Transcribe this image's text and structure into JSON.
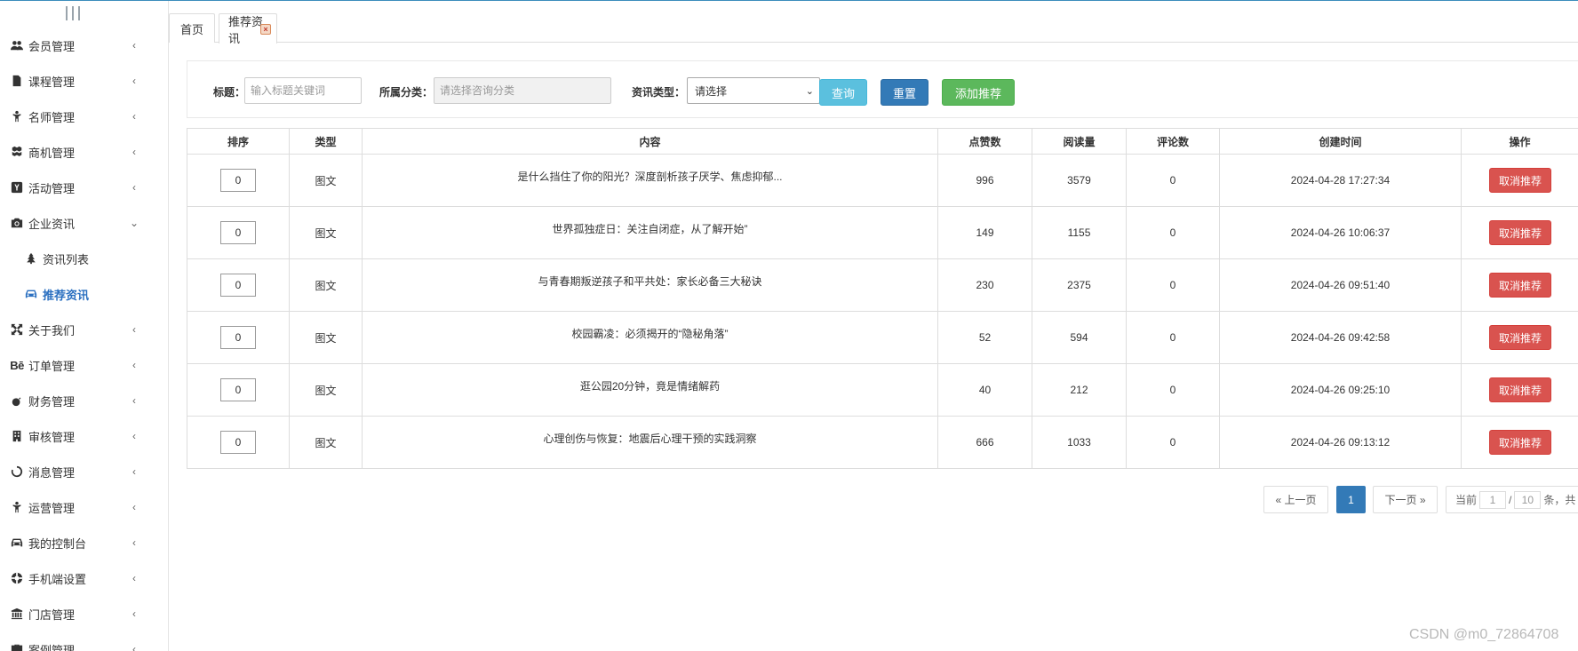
{
  "sidebar": {
    "items": [
      {
        "label": "会员管理",
        "icon": "users-icon",
        "chevron": "‹"
      },
      {
        "label": "课程管理",
        "icon": "file-icon",
        "chevron": "‹"
      },
      {
        "label": "名师管理",
        "icon": "child-icon",
        "chevron": "‹"
      },
      {
        "label": "商机管理",
        "icon": "cubes-icon",
        "chevron": "‹"
      },
      {
        "label": "活动管理",
        "icon": "y-combinator-icon",
        "chevron": "‹"
      },
      {
        "label": "企业资讯",
        "icon": "camera-icon",
        "chevron": "⌄"
      },
      {
        "label": "资讯列表",
        "icon": "tree-icon"
      },
      {
        "label": "推荐资讯",
        "icon": "car-icon"
      },
      {
        "label": "关于我们",
        "icon": "expand-icon",
        "chevron": "‹"
      },
      {
        "label": "订单管理",
        "icon": "behance-icon",
        "chevron": "‹"
      },
      {
        "label": "财务管理",
        "icon": "bomb-icon",
        "chevron": "‹"
      },
      {
        "label": "审核管理",
        "icon": "building-icon",
        "chevron": "‹"
      },
      {
        "label": "消息管理",
        "icon": "circle-notch-icon",
        "chevron": "‹"
      },
      {
        "label": "运营管理",
        "icon": "child-icon",
        "chevron": "‹"
      },
      {
        "label": "我的控制台",
        "icon": "car-icon",
        "chevron": "‹"
      },
      {
        "label": "手机端设置",
        "icon": "life-ring-icon",
        "chevron": "‹"
      },
      {
        "label": "门店管理",
        "icon": "bank-icon",
        "chevron": "‹"
      },
      {
        "label": "案例管理",
        "icon": "case-icon",
        "chevron": "‹"
      }
    ],
    "behance_text": "Bē"
  },
  "tabs": [
    {
      "label": "首页"
    },
    {
      "label": "推荐资讯",
      "close": "×"
    }
  ],
  "filter": {
    "title_label": "标题：",
    "title_placeholder": "输入标题关键词",
    "category_label": "所属分类：",
    "category_placeholder": "请选择咨询分类",
    "type_label": "资讯类型：",
    "type_selected": "请选择",
    "type_arrow": "⌄",
    "query_button": "查询",
    "reset_button": "重置",
    "add_button": "添加推荐"
  },
  "table": {
    "headers": [
      "排序",
      "类型",
      "内容",
      "点赞数",
      "阅读量",
      "评论数",
      "创建时间",
      "操作"
    ],
    "action_label": "取消推荐",
    "rows": [
      {
        "sort": "0",
        "type": "图文",
        "content": "是什么挡住了你的阳光？深度剖析孩子厌学、焦虑抑郁...",
        "likes": "996",
        "reads": "3579",
        "comments": "0",
        "created": "2024-04-28 17:27:34"
      },
      {
        "sort": "0",
        "type": "图文",
        "content": "世界孤独症日：关注自闭症，从了解开始”",
        "likes": "149",
        "reads": "1155",
        "comments": "0",
        "created": "2024-04-26 10:06:37"
      },
      {
        "sort": "0",
        "type": "图文",
        "content": "与青春期叛逆孩子和平共处：家长必备三大秘诀",
        "likes": "230",
        "reads": "2375",
        "comments": "0",
        "created": "2024-04-26 09:51:40"
      },
      {
        "sort": "0",
        "type": "图文",
        "content": "校园霸凌：必须揭开的“隐秘角落”",
        "likes": "52",
        "reads": "594",
        "comments": "0",
        "created": "2024-04-26 09:42:58"
      },
      {
        "sort": "0",
        "type": "图文",
        "content": "逛公园20分钟，竟是情绪解药",
        "likes": "40",
        "reads": "212",
        "comments": "0",
        "created": "2024-04-26 09:25:10"
      },
      {
        "sort": "0",
        "type": "图文",
        "content": "心理创伤与恢复：地震后心理干预的实践洞察",
        "likes": "666",
        "reads": "1033",
        "comments": "0",
        "created": "2024-04-26 09:13:12"
      }
    ]
  },
  "pagination": {
    "prev": "« 上一页",
    "current": "1",
    "next": "下一页 »",
    "info_prefix": "当前",
    "page_value": "1",
    "separator": "/",
    "page_size": "10",
    "info_suffix": "条，共"
  },
  "watermark": "CSDN @m0_72864708"
}
